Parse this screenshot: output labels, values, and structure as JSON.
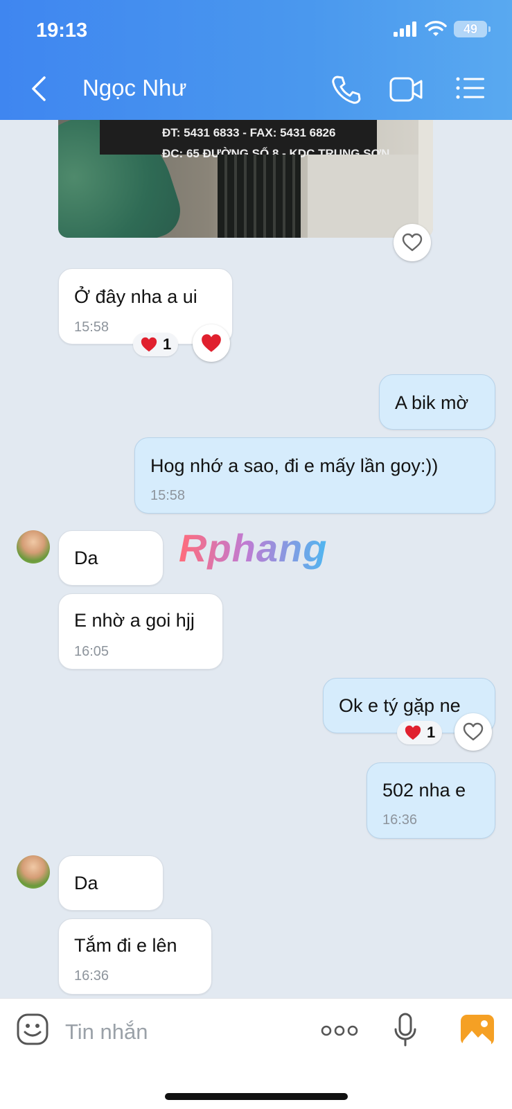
{
  "status_bar": {
    "time": "19:13",
    "battery": "49"
  },
  "header": {
    "contact_name": "Ngọc Như"
  },
  "photo": {
    "sign_line1": "ĐT: 5431 6833 - FAX: 5431 6826",
    "sign_line2": "ĐC: 65 ĐƯỜNG SỐ 8 - KDC TRUNG SƠN"
  },
  "messages": [
    {
      "side": "in",
      "text": "Ở đây nha a ui",
      "time": "15:58",
      "reaction_count": "1"
    },
    {
      "side": "out",
      "text": "A bik mờ"
    },
    {
      "side": "out",
      "text": "Hog nhớ a sao, đi e mấy lần goy:))",
      "time": "15:58"
    },
    {
      "side": "in",
      "text": "Da"
    },
    {
      "side": "in",
      "text": "E nhờ a goi hjj",
      "time": "16:05"
    },
    {
      "side": "out",
      "text": "Ok e tý gặp ne",
      "reaction_count": "1"
    },
    {
      "side": "out",
      "text": "502 nha e",
      "time": "16:36"
    },
    {
      "side": "in",
      "text": "Da"
    },
    {
      "side": "in",
      "text": "Tắm đi e lên",
      "time": "16:36"
    }
  ],
  "watermark": "Rphang",
  "composer": {
    "placeholder": "Tin nhắn"
  },
  "colors": {
    "header": "#4a94ee",
    "outgoing_bubble": "#d6ecfc",
    "incoming_bubble": "#ffffff",
    "background": "#e2e9f1",
    "heart": "#e0202e"
  }
}
